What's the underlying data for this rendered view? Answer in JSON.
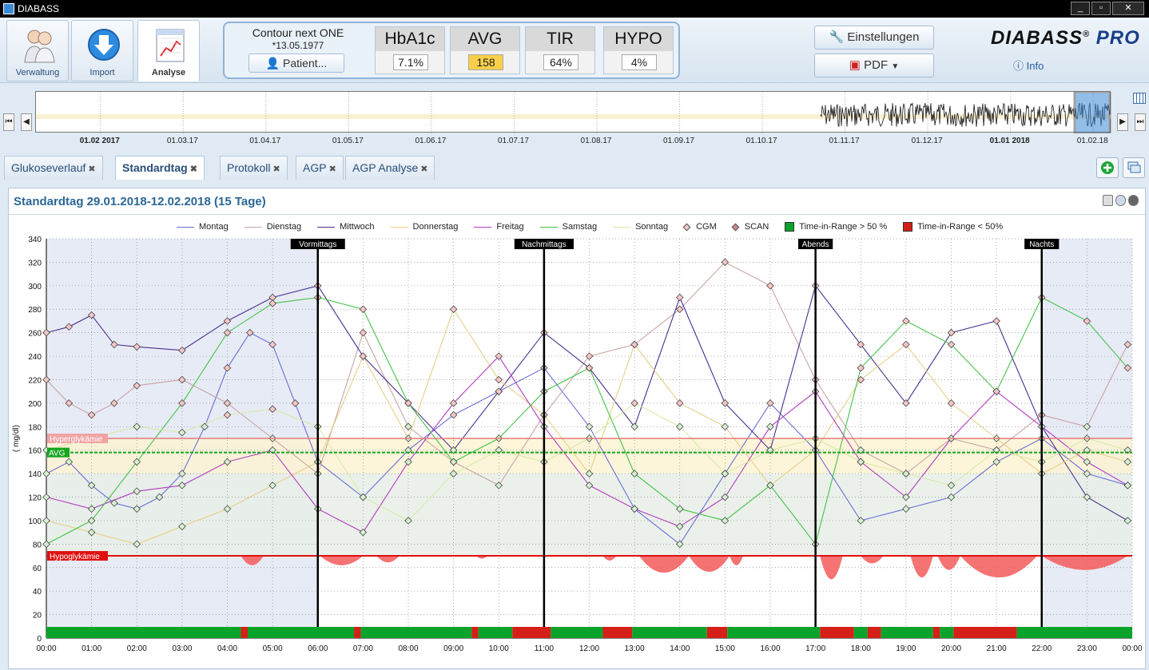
{
  "window": {
    "title": "DIABASS",
    "minimize": "_",
    "maximize": "▫",
    "close": "✕"
  },
  "nav": [
    {
      "id": "verwaltung",
      "label": "Verwaltung",
      "icon": "users-icon"
    },
    {
      "id": "import",
      "label": "Import",
      "icon": "download-arrow-icon"
    },
    {
      "id": "analyse",
      "label": "Analyse",
      "icon": "report-chart-icon",
      "active": true
    }
  ],
  "patient": {
    "device": "Contour next ONE",
    "dob": "*13.05.1977",
    "button": "Patient..."
  },
  "kpis": [
    {
      "label": "HbA1c",
      "value": "7.1%"
    },
    {
      "label": "AVG",
      "value": "158",
      "highlight": true
    },
    {
      "label": "TIR",
      "value": "64%"
    },
    {
      "label": "HYPO",
      "value": "4%"
    }
  ],
  "toolbar": {
    "settings": "Einstellungen",
    "pdf": "PDF",
    "info": "Info"
  },
  "brand": {
    "name": "DIABASS",
    "reg": "®",
    "edition": "PRO"
  },
  "timeline": {
    "labels": [
      {
        "text": "01.02 2017",
        "bold": true
      },
      {
        "text": "01.03.17"
      },
      {
        "text": "01.04.17"
      },
      {
        "text": "01.05.17"
      },
      {
        "text": "01.06.17"
      },
      {
        "text": "01.07.17"
      },
      {
        "text": "01.08.17"
      },
      {
        "text": "01.09.17"
      },
      {
        "text": "01.10.17"
      },
      {
        "text": "01.11.17"
      },
      {
        "text": "01.12.17"
      },
      {
        "text": "01.01 2018",
        "bold": true
      },
      {
        "text": "01.02.18"
      }
    ]
  },
  "tabs": [
    {
      "label": "Glukoseverlauf"
    },
    {
      "label": "Standardtag",
      "active": true
    },
    {
      "label": "Protokoll"
    },
    {
      "label": "AGP"
    },
    {
      "label": "AGP Analyse"
    }
  ],
  "panel": {
    "title": "Standardtag 29.01.2018-12.02.2018 (15 Tage)"
  },
  "colors": {
    "accent": "#2b6796",
    "in_range": "#0aa32b",
    "out_range": "#d42016",
    "hypo_fill": "#f55b5b",
    "hyper_line": "#e07b7b",
    "avg_line": "#15a51e",
    "target_band": "#e8efe6",
    "upper_band": "#fbf3d4",
    "night_shade": "#e7ebf5"
  },
  "chart_data": {
    "type": "scatter",
    "title": "Standardtag 29.01.2018-12.02.2018 (15 Tage)",
    "xlabel": "",
    "ylabel": "( mg/dl)",
    "ylim": [
      0,
      340
    ],
    "xlim_hours": [
      0,
      24
    ],
    "yticks": [
      0,
      20,
      40,
      60,
      80,
      100,
      120,
      140,
      160,
      180,
      200,
      220,
      240,
      260,
      280,
      300,
      320,
      340
    ],
    "xtick_labels": [
      "00:00",
      "01:00",
      "02:00",
      "03:00",
      "04:00",
      "05:00",
      "06:00",
      "07:00",
      "08:00",
      "09:00",
      "10:00",
      "11:00",
      "12:00",
      "13:00",
      "14:00",
      "15:00",
      "16:00",
      "17:00",
      "18:00",
      "19:00",
      "20:00",
      "21:00",
      "22:00",
      "23:00",
      "00:00"
    ],
    "thresholds": {
      "hyper": {
        "label": "Hyperglykämie",
        "value": 170
      },
      "avg": {
        "label": "AVG",
        "value": 158
      },
      "hypo": {
        "label": "Hypoglykämie",
        "value": 70
      }
    },
    "target_range": [
      70,
      140
    ],
    "periods": [
      {
        "label": "Vormittags",
        "hour": 6
      },
      {
        "label": "Nachmittags",
        "hour": 11
      },
      {
        "label": "Abends",
        "hour": 17
      },
      {
        "label": "Nachts",
        "hour": 22
      }
    ],
    "legend": [
      {
        "label": "Montag",
        "kind": "line",
        "color": "#6a6fd6"
      },
      {
        "label": "Dienstag",
        "kind": "line",
        "color": "#c9a4a4"
      },
      {
        "label": "Mittwoch",
        "kind": "line",
        "color": "#4a2f8f"
      },
      {
        "label": "Donnerstag",
        "kind": "line",
        "color": "#e6cf86"
      },
      {
        "label": "Freitag",
        "kind": "line",
        "color": "#b13cc0"
      },
      {
        "label": "Samstag",
        "kind": "line",
        "color": "#45c24a"
      },
      {
        "label": "Sonntag",
        "kind": "line",
        "color": "#d8e9a6"
      },
      {
        "label": "CGM",
        "kind": "diamond",
        "color": "#f4c6c6"
      },
      {
        "label": "SCAN",
        "kind": "scan",
        "color": "#f4c6c6"
      },
      {
        "label": "Time-in-Range > 50 %",
        "kind": "box",
        "color": "#0aa32b"
      },
      {
        "label": "Time-in-Range < 50%",
        "kind": "box",
        "color": "#d42016"
      }
    ],
    "series": [
      {
        "name": "Montag",
        "color": "#6a6fd6",
        "x": [
          0,
          0.5,
          1,
          1.5,
          2,
          2.5,
          3,
          3.5,
          4,
          4.5,
          5,
          5.5,
          6,
          7,
          8,
          9,
          10,
          11,
          12,
          13,
          14,
          15,
          16,
          17,
          18,
          19,
          20,
          21,
          22,
          23,
          23.9
        ],
        "y": [
          140,
          150,
          130,
          115,
          110,
          120,
          140,
          180,
          230,
          260,
          250,
          200,
          150,
          120,
          160,
          190,
          210,
          230,
          180,
          110,
          80,
          140,
          200,
          160,
          100,
          110,
          120,
          150,
          170,
          140,
          130
        ]
      },
      {
        "name": "Dienstag",
        "color": "#c9a4a4",
        "x": [
          0,
          0.5,
          1,
          1.5,
          2,
          3,
          4,
          5,
          6,
          7,
          8,
          9,
          10,
          11,
          12,
          13,
          14,
          15,
          16,
          17,
          18,
          19,
          20,
          21,
          22,
          23,
          23.9
        ],
        "y": [
          220,
          200,
          190,
          200,
          215,
          220,
          200,
          170,
          140,
          260,
          180,
          150,
          130,
          190,
          240,
          250,
          280,
          320,
          300,
          220,
          160,
          140,
          170,
          160,
          190,
          180,
          250
        ]
      },
      {
        "name": "Mittwoch",
        "color": "#4a2f8f",
        "x": [
          0,
          0.5,
          1,
          1.5,
          2,
          3,
          4,
          5,
          6,
          7,
          8,
          9,
          10,
          11,
          12,
          13,
          14,
          15,
          16,
          17,
          18,
          19,
          20,
          21,
          22,
          23,
          23.9
        ],
        "y": [
          260,
          265,
          275,
          250,
          248,
          245,
          270,
          290,
          300,
          240,
          200,
          160,
          210,
          260,
          230,
          180,
          290,
          200,
          160,
          300,
          250,
          200,
          260,
          270,
          180,
          120,
          100
        ]
      },
      {
        "name": "Donnerstag",
        "color": "#e6cf86",
        "x": [
          0,
          1,
          2,
          3,
          4,
          5,
          6,
          7,
          8,
          9,
          10,
          11,
          12,
          13,
          14,
          15,
          16,
          17,
          18,
          19,
          20,
          21,
          22,
          23,
          23.9
        ],
        "y": [
          100,
          90,
          80,
          95,
          110,
          130,
          150,
          240,
          170,
          280,
          220,
          190,
          140,
          250,
          200,
          180,
          130,
          160,
          220,
          250,
          200,
          170,
          140,
          160,
          150
        ]
      },
      {
        "name": "Freitag",
        "color": "#b13cc0",
        "x": [
          0,
          1,
          2,
          3,
          4,
          5,
          6,
          7,
          8,
          9,
          10,
          11,
          12,
          13,
          14,
          15,
          16,
          17,
          18,
          19,
          20,
          21,
          22,
          23,
          23.9
        ],
        "y": [
          120,
          110,
          125,
          130,
          150,
          160,
          110,
          90,
          150,
          200,
          240,
          180,
          130,
          110,
          95,
          120,
          180,
          210,
          150,
          120,
          170,
          210,
          180,
          150,
          130
        ]
      },
      {
        "name": "Samstag",
        "color": "#45c24a",
        "x": [
          0,
          1,
          2,
          3,
          4,
          5,
          6,
          7,
          8,
          9,
          10,
          11,
          12,
          13,
          14,
          15,
          16,
          17,
          18,
          19,
          20,
          21,
          22,
          23,
          23.9
        ],
        "y": [
          80,
          100,
          150,
          200,
          260,
          285,
          290,
          280,
          200,
          150,
          170,
          210,
          230,
          140,
          110,
          100,
          130,
          80,
          230,
          270,
          250,
          210,
          290,
          270,
          230
        ]
      },
      {
        "name": "Sonntag",
        "color": "#d8e9a6",
        "x": [
          0,
          1,
          2,
          3,
          4,
          5,
          6,
          7,
          8,
          9,
          10,
          11,
          12,
          13,
          14,
          15,
          16,
          17,
          18,
          19,
          20,
          21,
          22,
          23,
          23.9
        ],
        "y": [
          160,
          170,
          180,
          175,
          190,
          195,
          180,
          120,
          100,
          140,
          160,
          150,
          170,
          200,
          180,
          140,
          160,
          170,
          150,
          140,
          130,
          160,
          150,
          170,
          160
        ]
      }
    ],
    "hypo_episodes": [
      {
        "x": [
          4.3,
          4.8
        ],
        "min": 60
      },
      {
        "x": [
          6.05,
          7.0
        ],
        "min": 60
      },
      {
        "x": [
          7.3,
          7.8
        ],
        "min": 63
      },
      {
        "x": [
          9.5,
          9.75
        ],
        "min": 67
      },
      {
        "x": [
          12.3,
          12.6
        ],
        "min": 65
      },
      {
        "x": [
          13.1,
          14.2
        ],
        "min": 52
      },
      {
        "x": [
          14.2,
          15.1
        ],
        "min": 53
      },
      {
        "x": [
          15.1,
          15.4
        ],
        "min": 60
      },
      {
        "x": [
          17.1,
          17.6
        ],
        "min": 45
      },
      {
        "x": [
          18.0,
          18.5
        ],
        "min": 62
      },
      {
        "x": [
          19.1,
          19.6
        ],
        "min": 47
      },
      {
        "x": [
          19.7,
          20.2
        ],
        "min": 55
      },
      {
        "x": [
          20.2,
          21.9
        ],
        "min": 47
      },
      {
        "x": [
          22.0,
          23.9
        ],
        "min": 55
      }
    ],
    "tir_bar": [
      {
        "from": 0,
        "to": 4.3,
        "in_range": true
      },
      {
        "from": 4.3,
        "to": 4.45,
        "in_range": false
      },
      {
        "from": 4.45,
        "to": 6.8,
        "in_range": true
      },
      {
        "from": 6.8,
        "to": 6.95,
        "in_range": false
      },
      {
        "from": 6.95,
        "to": 9.4,
        "in_range": true
      },
      {
        "from": 9.4,
        "to": 9.55,
        "in_range": false
      },
      {
        "from": 9.55,
        "to": 10.3,
        "in_range": true
      },
      {
        "from": 10.3,
        "to": 11.15,
        "in_range": false
      },
      {
        "from": 11.15,
        "to": 12.3,
        "in_range": true
      },
      {
        "from": 12.3,
        "to": 12.95,
        "in_range": false
      },
      {
        "from": 12.95,
        "to": 14.6,
        "in_range": true
      },
      {
        "from": 14.6,
        "to": 15.05,
        "in_range": false
      },
      {
        "from": 15.05,
        "to": 17.1,
        "in_range": true
      },
      {
        "from": 17.1,
        "to": 17.85,
        "in_range": false
      },
      {
        "from": 17.85,
        "to": 18.15,
        "in_range": true
      },
      {
        "from": 18.15,
        "to": 18.45,
        "in_range": false
      },
      {
        "from": 18.45,
        "to": 19.6,
        "in_range": true
      },
      {
        "from": 19.6,
        "to": 19.75,
        "in_range": false
      },
      {
        "from": 19.75,
        "to": 20.05,
        "in_range": true
      },
      {
        "from": 20.05,
        "to": 21.45,
        "in_range": false
      },
      {
        "from": 21.45,
        "to": 24,
        "in_range": true
      }
    ]
  }
}
